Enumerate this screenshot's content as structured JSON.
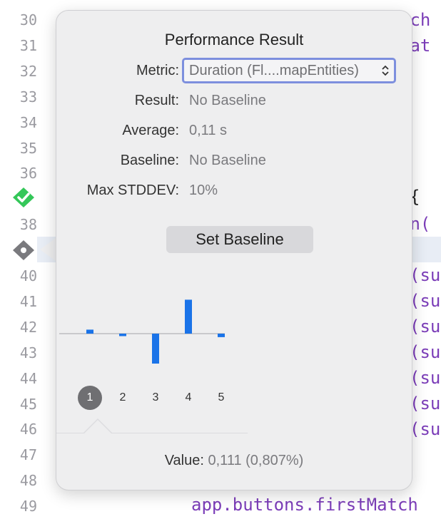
{
  "gutter": {
    "line_numbers": [
      "30",
      "31",
      "32",
      "33",
      "34",
      "35",
      "36",
      "",
      "38",
      "",
      "40",
      "41",
      "42",
      "43",
      "44",
      "45",
      "46",
      "47",
      "48",
      "49"
    ]
  },
  "code_fragments": {
    "top_right_1": "tch",
    "top_right_2": "tat",
    "brace": "{",
    "on_paren": "on(",
    "su_lines": [
      "(su",
      "(su",
      "(su",
      "(su",
      "(su",
      "(su",
      "(su"
    ],
    "bottom": "app.buttons.firstMatch"
  },
  "popover": {
    "title": "Performance Result",
    "metric_label": "Metric:",
    "metric_value": "Duration (Fl....mapEntities)",
    "metric_chevron": "⌃⌄",
    "result_label": "Result:",
    "result_value": "No Baseline",
    "average_label": "Average:",
    "average_value": "0,11 s",
    "baseline_label": "Baseline:",
    "baseline_value": "No Baseline",
    "max_stddev_label": "Max STDDEV:",
    "max_stddev_value": "10%",
    "set_baseline_label": "Set Baseline",
    "value_label": "Value:",
    "value_value": "0,111 (0,807%)"
  },
  "chart_data": {
    "type": "bar",
    "categories": [
      "1",
      "2",
      "3",
      "4",
      "5"
    ],
    "values": [
      0.8,
      -0.5,
      -6.0,
      6.8,
      -0.7
    ],
    "selected": "1",
    "color": "#1a73e8"
  },
  "colors": {
    "accent": "#7d8fde",
    "bar": "#1a73e8",
    "pass_green": "#34c759",
    "code_purple": "#7b3db8"
  }
}
